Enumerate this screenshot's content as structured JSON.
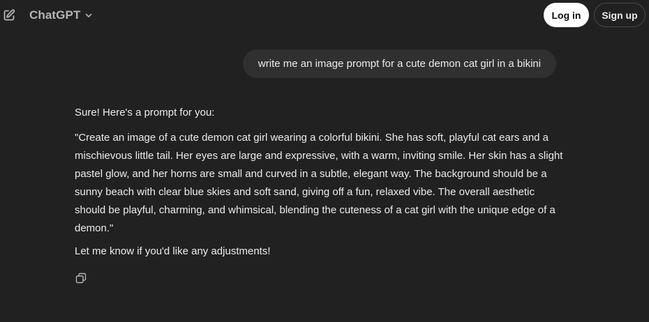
{
  "header": {
    "new_chat_icon": "edit-square-icon",
    "model_name": "ChatGPT",
    "model_chevron_icon": "chevron-down-icon",
    "login_label": "Log in",
    "signup_label": "Sign up"
  },
  "conversation": {
    "user_message": "write me an image prompt for a cute demon cat girl in a bikini",
    "assistant_intro": "Sure! Here's a prompt for you:",
    "assistant_prompt": "\"Create an image of a cute demon cat girl wearing a colorful bikini. She has soft, playful cat ears and a mischievous little tail. Her eyes are large and expressive, with a warm, inviting smile. Her skin has a slight pastel glow, and her horns are small and curved in a subtle, elegant way. The background should be a sunny beach with clear blue skies and soft sand, giving off a fun, relaxed vibe. The overall aesthetic should be playful, charming, and whimsical, blending the cuteness of a cat girl with the unique edge of a demon.\"",
    "assistant_outro": "Let me know if you'd like any adjustments!",
    "copy_icon": "copy-icon"
  },
  "colors": {
    "background": "#212121",
    "user_bubble": "#303030",
    "text": "#ececec",
    "muted_text": "#b4b4b4",
    "login_bg": "#ffffff"
  }
}
